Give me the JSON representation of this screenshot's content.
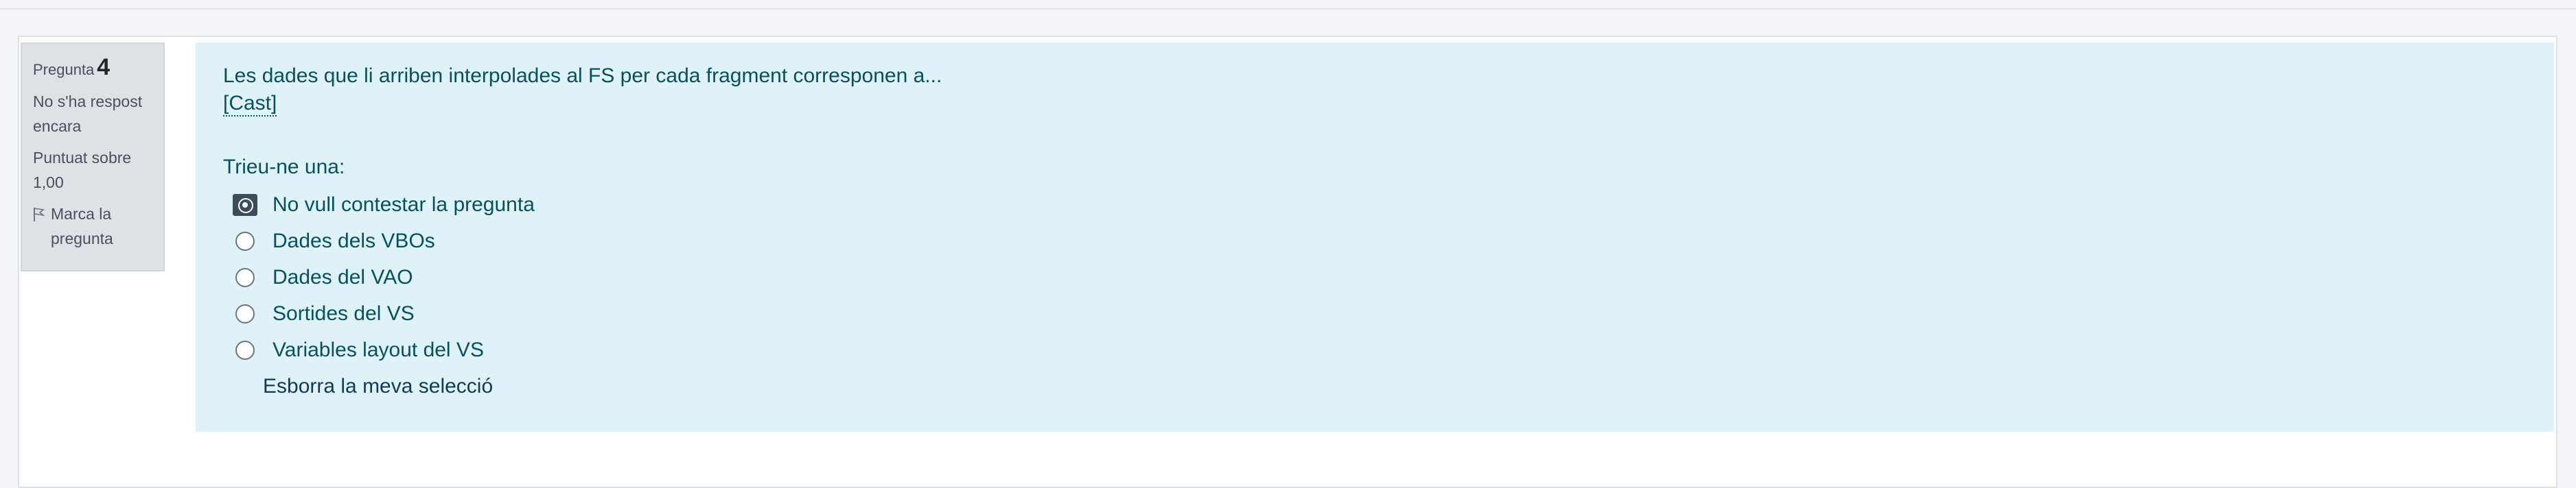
{
  "question_info": {
    "label": "Pregunta",
    "number": "4",
    "state": "No s'ha respost encara",
    "grade": "Puntuat sobre 1,00",
    "flag_label": "Marca la pregunta"
  },
  "question": {
    "text": "Les dades que li arriben interpolades al FS per cada fragment corresponen a...",
    "cast_link": "[Cast]",
    "prompt": "Trieu-ne una:",
    "answers": [
      {
        "label": "No vull contestar la pregunta",
        "selected": true
      },
      {
        "label": "Dades dels VBOs",
        "selected": false
      },
      {
        "label": "Dades del VAO",
        "selected": false
      },
      {
        "label": "Sortides del VS",
        "selected": false
      },
      {
        "label": "Variables layout del VS",
        "selected": false
      }
    ],
    "clear_label": "Esborra la meva selecció"
  },
  "colors": {
    "info_bg": "#dee2e6",
    "content_bg": "#def2f7",
    "text": "#055160"
  }
}
